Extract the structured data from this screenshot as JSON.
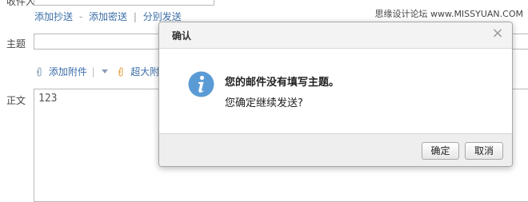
{
  "compose": {
    "recipient_label": "收件人",
    "recipient_value": "",
    "links": [
      "添加抄送",
      "添加密送",
      "分别发送"
    ],
    "link_separators": [
      "-",
      "|"
    ],
    "subject_label": "主题",
    "attach_label": "添加附件",
    "big_attach_label": "超大附件",
    "body_label": "正文",
    "body_text": "123"
  },
  "watermark": "思缘设计论坛 www.MISSYUAN.COM",
  "dialog": {
    "title": "确认",
    "message": "您的邮件没有填写主题。",
    "question": "您确定继续发送?",
    "ok_label": "确定",
    "cancel_label": "取消",
    "icon": "info-icon",
    "icon_color": "#5b9bd5"
  }
}
